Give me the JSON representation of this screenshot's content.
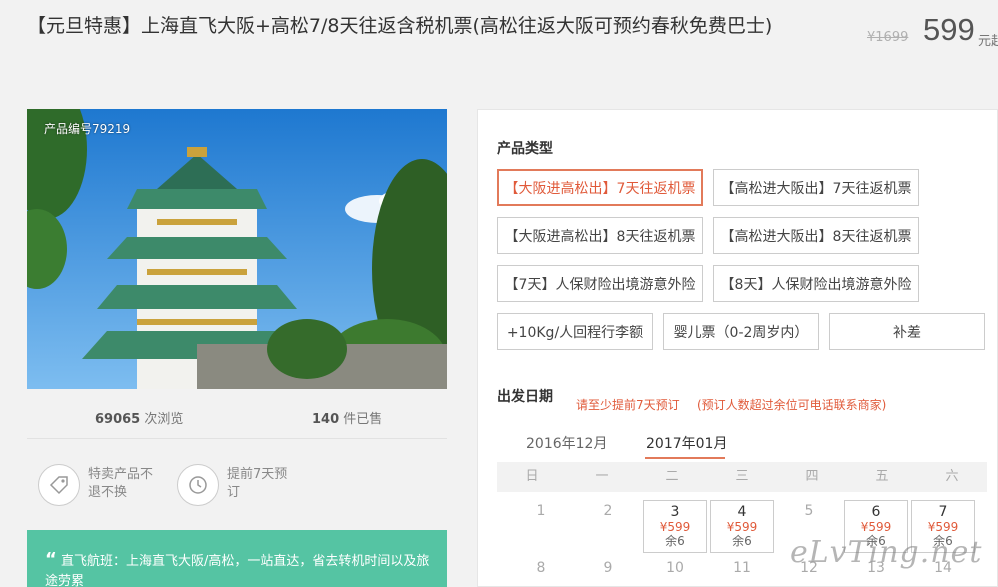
{
  "title": "【元旦特惠】上海直飞大阪+高松7/8天往返含税机票(高松往返大阪可预约春秋免费巴士)",
  "price": {
    "old": "¥1699",
    "current": "599",
    "unit": "元起"
  },
  "product_no": "产品编号79219",
  "stats": {
    "views_num": "69065",
    "views_label": "次浏览",
    "sold_num": "140",
    "sold_label": "件已售"
  },
  "features": [
    {
      "icon": "tag-icon",
      "text": "特卖产品不退不换"
    },
    {
      "icon": "clock-history-icon",
      "text": "提前7天预订"
    }
  ],
  "quote": {
    "mark": "“",
    "text": "直飞航班：上海直飞大阪/高松，一站直达，省去转机时间以及旅途劳累"
  },
  "product_type": {
    "label": "产品类型",
    "options": [
      "【大阪进高松出】7天往返机票",
      "【高松进大阪出】7天往返机票",
      "【大阪进高松出】8天往返机票",
      "【高松进大阪出】8天往返机票",
      "【7天】人保财险出境游意外险",
      "【8天】人保财险出境游意外险",
      "+10Kg/人回程行李额",
      "婴儿票（0-2周岁内）",
      "补差"
    ],
    "selected_index": 0
  },
  "departure": {
    "label": "出发日期",
    "hint1": "请至少提前7天预订",
    "hint2": "(预订人数超过余位可电话联系商家)",
    "months": [
      "2016年12月",
      "2017年01月"
    ],
    "weekdays": [
      "日",
      "一",
      "二",
      "三",
      "四",
      "五",
      "六"
    ],
    "row1": [
      {
        "day": "1"
      },
      {
        "day": "2"
      },
      {
        "day": "3",
        "price": "¥599",
        "left": "余6"
      },
      {
        "day": "4",
        "price": "¥599",
        "left": "余6"
      },
      {
        "day": "5"
      },
      {
        "day": "6",
        "price": "¥599",
        "left": "余6"
      },
      {
        "day": "7",
        "price": "¥599",
        "left": "余6"
      }
    ],
    "row2": [
      "8",
      "9",
      "10",
      "11",
      "12",
      "13",
      "14"
    ]
  },
  "watermark": "eLvTing.net",
  "colors": {
    "accent": "#e05a3a",
    "quote_bg": "#55c4a3"
  }
}
